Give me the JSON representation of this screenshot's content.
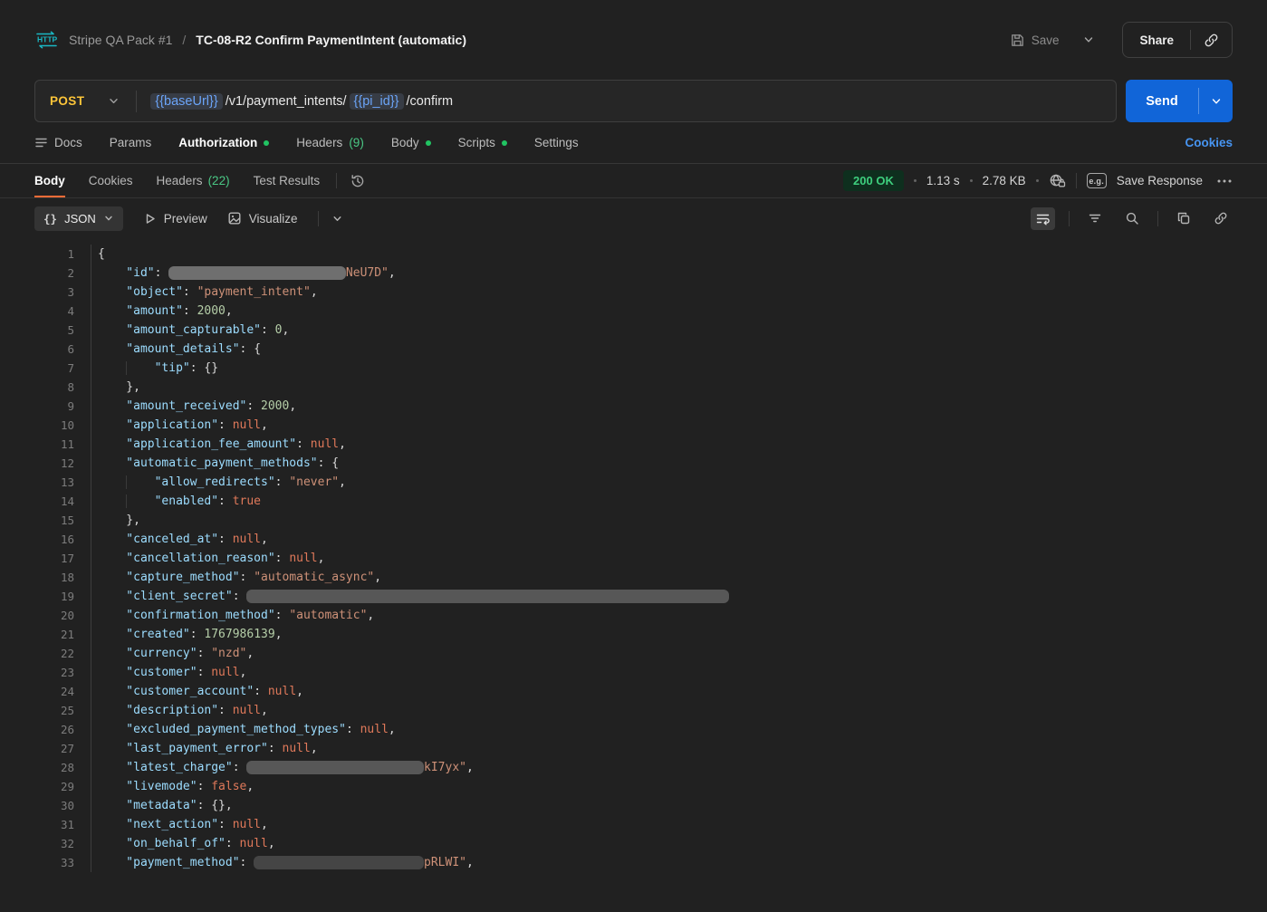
{
  "header": {
    "breadcrumb": {
      "collection": "Stripe QA Pack #1",
      "separator": "/",
      "request_name": "TC-08-R2 Confirm PaymentIntent (automatic)"
    },
    "save_label": "Save",
    "share_label": "Share"
  },
  "request": {
    "method": "POST",
    "url_segments": [
      {
        "type": "var",
        "text": "{{baseUrl}}"
      },
      {
        "type": "plain",
        "text": "/v1/payment_intents/"
      },
      {
        "type": "var",
        "text": "{{pi_id}}"
      },
      {
        "type": "plain",
        "text": "/confirm"
      }
    ],
    "send_label": "Send"
  },
  "request_tabs": [
    {
      "label": "Docs",
      "icon": "menu"
    },
    {
      "label": "Params"
    },
    {
      "label": "Authorization",
      "active": true,
      "dot": true
    },
    {
      "label": "Headers",
      "count": "(9)"
    },
    {
      "label": "Body",
      "dot": true
    },
    {
      "label": "Scripts",
      "dot": true
    },
    {
      "label": "Settings"
    }
  ],
  "cookies_link": "Cookies",
  "response": {
    "tabs": [
      {
        "label": "Body",
        "active": true
      },
      {
        "label": "Cookies"
      },
      {
        "label": "Headers",
        "count": "(22)"
      },
      {
        "label": "Test Results"
      }
    ],
    "status": "200 OK",
    "time": "1.13 s",
    "size": "2.78 KB",
    "example_badge": "e.g.",
    "save_response_label": "Save Response"
  },
  "toolbar": {
    "format_braces": "{}",
    "format": "JSON",
    "preview_label": "Preview",
    "visualize_label": "Visualize"
  },
  "code": {
    "lines": [
      {
        "i": 0,
        "t": [
          [
            "p",
            "{"
          ]
        ]
      },
      {
        "i": 1,
        "t": [
          [
            "k",
            "\"id\""
          ],
          [
            "p",
            ": "
          ],
          [
            "r",
            25,
            "#6f6f6f"
          ],
          [
            "s",
            "NeU7D\""
          ],
          [
            "p",
            ","
          ]
        ]
      },
      {
        "i": 1,
        "t": [
          [
            "k",
            "\"object\""
          ],
          [
            "p",
            ": "
          ],
          [
            "s",
            "\"payment_intent\""
          ],
          [
            "p",
            ","
          ]
        ]
      },
      {
        "i": 1,
        "t": [
          [
            "k",
            "\"amount\""
          ],
          [
            "p",
            ": "
          ],
          [
            "n",
            "2000"
          ],
          [
            "p",
            ","
          ]
        ]
      },
      {
        "i": 1,
        "t": [
          [
            "k",
            "\"amount_capturable\""
          ],
          [
            "p",
            ": "
          ],
          [
            "n",
            "0"
          ],
          [
            "p",
            ","
          ]
        ]
      },
      {
        "i": 1,
        "t": [
          [
            "k",
            "\"amount_details\""
          ],
          [
            "p",
            ": "
          ],
          [
            "p",
            "{"
          ]
        ]
      },
      {
        "i": 2,
        "t": [
          [
            "k",
            "\"tip\""
          ],
          [
            "p",
            ": "
          ],
          [
            "p",
            "{}"
          ]
        ]
      },
      {
        "i": 1,
        "t": [
          [
            "p",
            "},"
          ]
        ]
      },
      {
        "i": 1,
        "t": [
          [
            "k",
            "\"amount_received\""
          ],
          [
            "p",
            ": "
          ],
          [
            "n",
            "2000"
          ],
          [
            "p",
            ","
          ]
        ]
      },
      {
        "i": 1,
        "t": [
          [
            "k",
            "\"application\""
          ],
          [
            "p",
            ": "
          ],
          [
            "w",
            "null"
          ],
          [
            "p",
            ","
          ]
        ]
      },
      {
        "i": 1,
        "t": [
          [
            "k",
            "\"application_fee_amount\""
          ],
          [
            "p",
            ": "
          ],
          [
            "w",
            "null"
          ],
          [
            "p",
            ","
          ]
        ]
      },
      {
        "i": 1,
        "t": [
          [
            "k",
            "\"automatic_payment_methods\""
          ],
          [
            "p",
            ": "
          ],
          [
            "p",
            "{"
          ]
        ]
      },
      {
        "i": 2,
        "t": [
          [
            "k",
            "\"allow_redirects\""
          ],
          [
            "p",
            ": "
          ],
          [
            "s",
            "\"never\""
          ],
          [
            "p",
            ","
          ]
        ]
      },
      {
        "i": 2,
        "t": [
          [
            "k",
            "\"enabled\""
          ],
          [
            "p",
            ": "
          ],
          [
            "w",
            "true"
          ]
        ]
      },
      {
        "i": 1,
        "t": [
          [
            "p",
            "},"
          ]
        ]
      },
      {
        "i": 1,
        "t": [
          [
            "k",
            "\"canceled_at\""
          ],
          [
            "p",
            ": "
          ],
          [
            "w",
            "null"
          ],
          [
            "p",
            ","
          ]
        ]
      },
      {
        "i": 1,
        "t": [
          [
            "k",
            "\"cancellation_reason\""
          ],
          [
            "p",
            ": "
          ],
          [
            "w",
            "null"
          ],
          [
            "p",
            ","
          ]
        ]
      },
      {
        "i": 1,
        "t": [
          [
            "k",
            "\"capture_method\""
          ],
          [
            "p",
            ": "
          ],
          [
            "s",
            "\"automatic_async\""
          ],
          [
            "p",
            ","
          ]
        ]
      },
      {
        "i": 1,
        "t": [
          [
            "k",
            "\"client_secret\""
          ],
          [
            "p",
            ": "
          ],
          [
            "r",
            68,
            "#575757"
          ]
        ]
      },
      {
        "i": 1,
        "t": [
          [
            "k",
            "\"confirmation_method\""
          ],
          [
            "p",
            ": "
          ],
          [
            "s",
            "\"automatic\""
          ],
          [
            "p",
            ","
          ]
        ]
      },
      {
        "i": 1,
        "t": [
          [
            "k",
            "\"created\""
          ],
          [
            "p",
            ": "
          ],
          [
            "n",
            "1767986139"
          ],
          [
            "p",
            ","
          ]
        ]
      },
      {
        "i": 1,
        "t": [
          [
            "k",
            "\"currency\""
          ],
          [
            "p",
            ": "
          ],
          [
            "s",
            "\"nzd\""
          ],
          [
            "p",
            ","
          ]
        ]
      },
      {
        "i": 1,
        "t": [
          [
            "k",
            "\"customer\""
          ],
          [
            "p",
            ": "
          ],
          [
            "w",
            "null"
          ],
          [
            "p",
            ","
          ]
        ]
      },
      {
        "i": 1,
        "t": [
          [
            "k",
            "\"customer_account\""
          ],
          [
            "p",
            ": "
          ],
          [
            "w",
            "null"
          ],
          [
            "p",
            ","
          ]
        ]
      },
      {
        "i": 1,
        "t": [
          [
            "k",
            "\"description\""
          ],
          [
            "p",
            ": "
          ],
          [
            "w",
            "null"
          ],
          [
            "p",
            ","
          ]
        ]
      },
      {
        "i": 1,
        "t": [
          [
            "k",
            "\"excluded_payment_method_types\""
          ],
          [
            "p",
            ": "
          ],
          [
            "w",
            "null"
          ],
          [
            "p",
            ","
          ]
        ]
      },
      {
        "i": 1,
        "t": [
          [
            "k",
            "\"last_payment_error\""
          ],
          [
            "p",
            ": "
          ],
          [
            "w",
            "null"
          ],
          [
            "p",
            ","
          ]
        ]
      },
      {
        "i": 1,
        "t": [
          [
            "k",
            "\"latest_charge\""
          ],
          [
            "p",
            ": "
          ],
          [
            "r",
            25,
            "#575757"
          ],
          [
            "s",
            "kI7yx\""
          ],
          [
            "p",
            ","
          ]
        ]
      },
      {
        "i": 1,
        "t": [
          [
            "k",
            "\"livemode\""
          ],
          [
            "p",
            ": "
          ],
          [
            "w",
            "false"
          ],
          [
            "p",
            ","
          ]
        ]
      },
      {
        "i": 1,
        "t": [
          [
            "k",
            "\"metadata\""
          ],
          [
            "p",
            ": "
          ],
          [
            "p",
            "{}"
          ],
          [
            "p",
            ","
          ]
        ]
      },
      {
        "i": 1,
        "t": [
          [
            "k",
            "\"next_action\""
          ],
          [
            "p",
            ": "
          ],
          [
            "w",
            "null"
          ],
          [
            "p",
            ","
          ]
        ]
      },
      {
        "i": 1,
        "t": [
          [
            "k",
            "\"on_behalf_of\""
          ],
          [
            "p",
            ": "
          ],
          [
            "w",
            "null"
          ],
          [
            "p",
            ","
          ]
        ]
      },
      {
        "i": 1,
        "t": [
          [
            "k",
            "\"payment_method\""
          ],
          [
            "p",
            ": "
          ],
          [
            "r",
            24,
            "#454545"
          ],
          [
            "s",
            "pRLWI\""
          ],
          [
            "p",
            ","
          ]
        ]
      }
    ]
  },
  "colors": {
    "accent_orange": "#ff6c37",
    "send_blue": "#1165d8",
    "method_post": "#fdc539",
    "status_green": "#3ecf7e",
    "variable_blue": "#6ba4f8",
    "link_blue": "#4795f2"
  },
  "icons": [
    "http-method-icon",
    "save-icon",
    "chevron-down-icon",
    "share-link-icon",
    "docs-menu-icon",
    "history-icon",
    "globe-lock-icon",
    "example-badge-icon",
    "more-options-icon",
    "braces-icon",
    "preview-play-icon",
    "visualize-image-icon",
    "wrap-text-icon",
    "filter-icon",
    "search-icon",
    "copy-icon",
    "link-icon"
  ]
}
